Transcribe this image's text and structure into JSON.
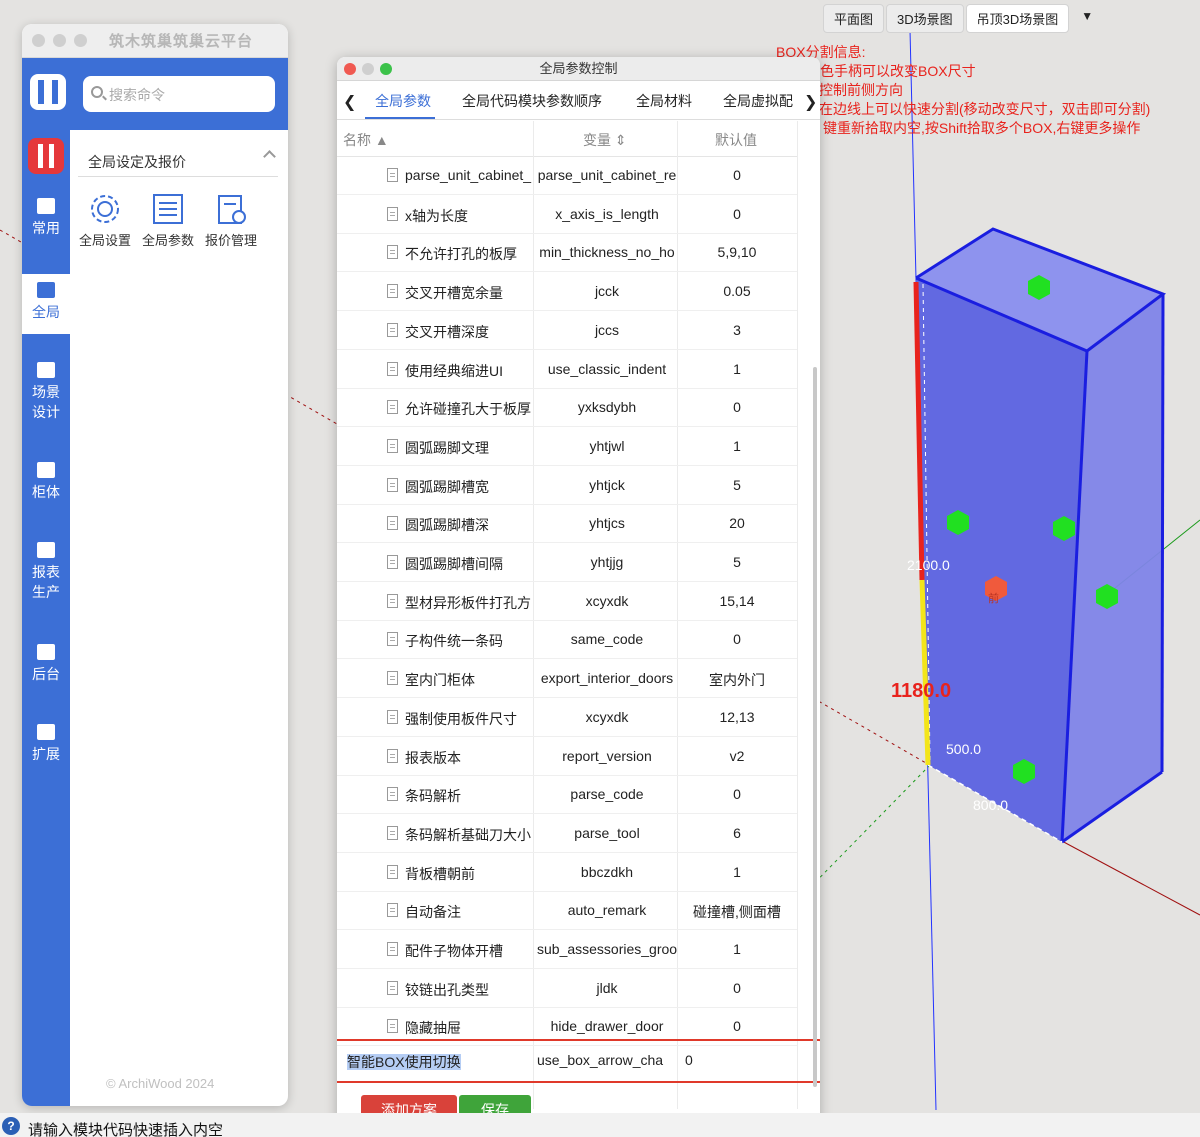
{
  "viewport": {
    "view_tabs": [
      "平面图",
      "3D场景图",
      "吊顶3D场景图"
    ],
    "view_tabs_active": 2,
    "view_dropdown": "▼",
    "box_info": [
      "BOX分割信息:",
      "色手柄可以改变BOX尺寸",
      "控制前侧方向",
      "在边线上可以快速分割(移动改变尺寸，双击即可分割)",
      "键重新拾取内空,按Shift拾取多个BOX,右键更多操作"
    ],
    "dims": {
      "height": "2100.0",
      "split": "1180.0",
      "depth": "500.0",
      "width": "800.0",
      "front": "前"
    },
    "colors": {
      "box_face": "#5b62e0",
      "box_edge": "#1a1ee0",
      "handle": "#21e021",
      "front_handle": "#f05a3c"
    }
  },
  "app": {
    "title": "筑木筑巢筑巢云平台",
    "search_placeholder": "搜索命令",
    "section_title": "全局设定及报价",
    "tools": [
      "全局设置",
      "全局参数",
      "报价管理"
    ],
    "sidebar": [
      {
        "label": "常用",
        "icon": "terminal-icon"
      },
      {
        "label": "全局",
        "icon": "global-settings-icon"
      },
      {
        "label": "场景设计",
        "icon": "scene-design-icon"
      },
      {
        "label": "柜体",
        "icon": "cabinet-icon"
      },
      {
        "label": "报表生产",
        "icon": "report-icon"
      },
      {
        "label": "后台",
        "icon": "backend-icon"
      },
      {
        "label": "扩展",
        "icon": "extension-icon"
      }
    ],
    "copyright": "© ArchiWood 2024"
  },
  "dialog": {
    "title": "全局参数控制",
    "tabs": [
      "全局参数",
      "全局代码模块参数顺序",
      "全局材料",
      "全局虚拟配"
    ],
    "columns": {
      "name": "名称",
      "variable": "变量",
      "default": "默认值"
    },
    "rows": [
      {
        "name": "parse_unit_cabinet_",
        "var": "parse_unit_cabinet_re",
        "def": "0"
      },
      {
        "name": "x轴为长度",
        "var": "x_axis_is_length",
        "def": "0"
      },
      {
        "name": "不允许打孔的板厚",
        "var": "min_thickness_no_ho",
        "def": "5,9,10"
      },
      {
        "name": "交叉开槽宽余量",
        "var": "jcck",
        "def": "0.05"
      },
      {
        "name": "交叉开槽深度",
        "var": "jccs",
        "def": "3"
      },
      {
        "name": "使用经典缩进UI",
        "var": "use_classic_indent",
        "def": "1"
      },
      {
        "name": "允许碰撞孔大于板厚",
        "var": "yxksdybh",
        "def": "0"
      },
      {
        "name": "圆弧踢脚文理",
        "var": "yhtjwl",
        "def": "1"
      },
      {
        "name": "圆弧踢脚槽宽",
        "var": "yhtjck",
        "def": "5"
      },
      {
        "name": "圆弧踢脚槽深",
        "var": "yhtjcs",
        "def": "20"
      },
      {
        "name": "圆弧踢脚槽间隔",
        "var": "yhtjjg",
        "def": "5"
      },
      {
        "name": "型材异形板件打孔方",
        "var": "xcyxdk",
        "def": "15,14"
      },
      {
        "name": "子构件统一条码",
        "var": "same_code",
        "def": "0"
      },
      {
        "name": "室内门柜体",
        "var": "export_interior_doors",
        "def": "室内外门"
      },
      {
        "name": "强制使用板件尺寸",
        "var": "xcyxdk",
        "def": "12,13"
      },
      {
        "name": "报表版本",
        "var": "report_version",
        "def": "v2"
      },
      {
        "name": "条码解析",
        "var": "parse_code",
        "def": "0"
      },
      {
        "name": "条码解析基础刀大小",
        "var": "parse_tool",
        "def": "6"
      },
      {
        "name": "背板槽朝前",
        "var": "bbczdkh",
        "def": "1"
      },
      {
        "name": "自动备注",
        "var": "auto_remark",
        "def": "碰撞槽,侧面槽"
      },
      {
        "name": "配件子物体开槽",
        "var": "sub_assessories_groo",
        "def": "1"
      },
      {
        "name": "铰链出孔类型",
        "var": "jldk",
        "def": "0"
      },
      {
        "name": "隐藏抽屉",
        "var": "hide_drawer_door",
        "def": "0"
      }
    ],
    "selected_row": {
      "name": "智能BOX使用切换",
      "var": "use_box_arrow_cha",
      "def": "0"
    },
    "buttons": {
      "add": "添加方案",
      "save": "保存"
    }
  },
  "status": {
    "icon": "?",
    "text": "请输入模块代码快速插入内空"
  }
}
